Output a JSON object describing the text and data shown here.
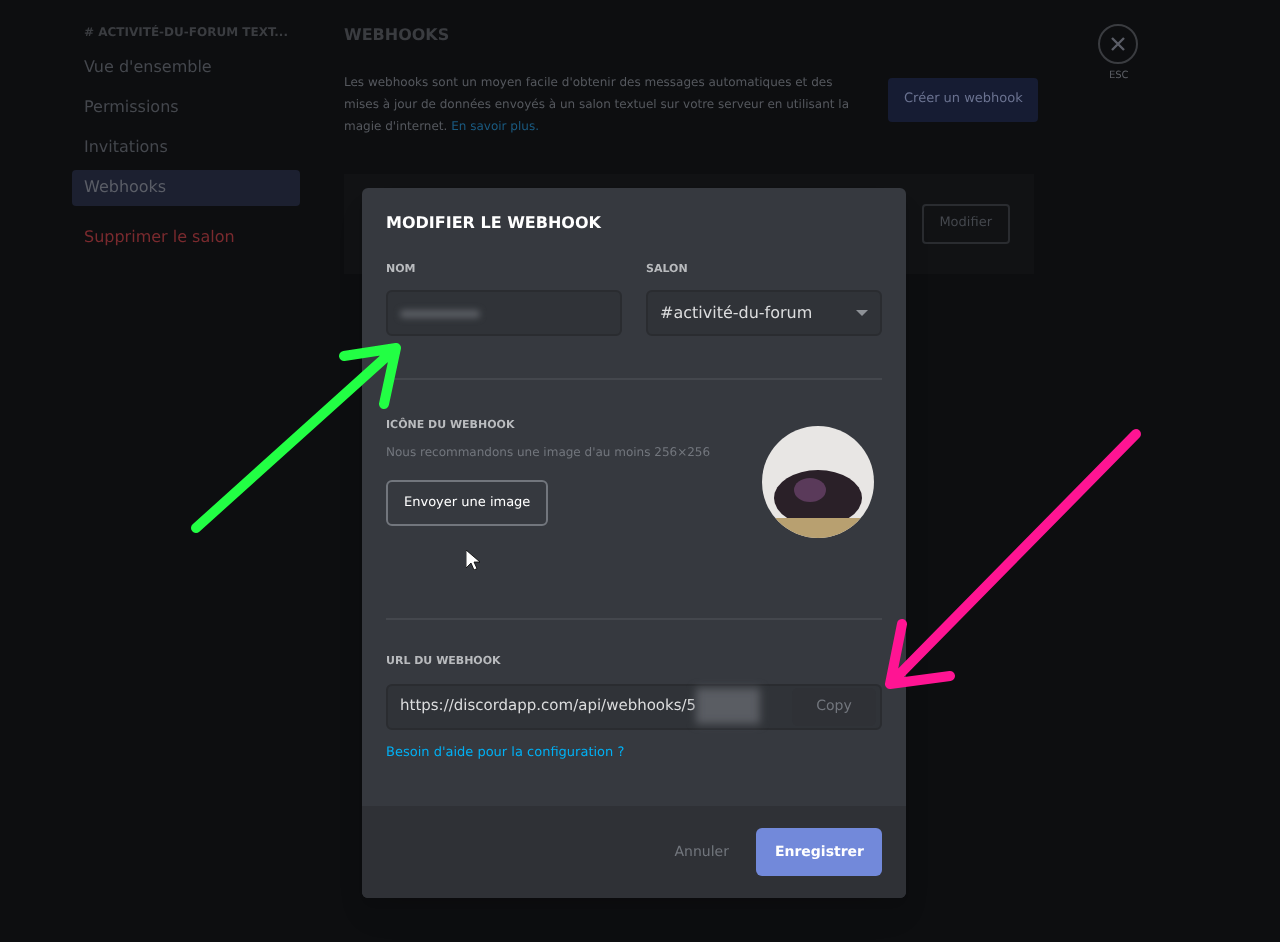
{
  "sidebar": {
    "header": "# ACTIVITÉ-DU-FORUM TEXT...",
    "items": [
      {
        "label": "Vue d'ensemble",
        "selected": false
      },
      {
        "label": "Permissions",
        "selected": false
      },
      {
        "label": "Invitations",
        "selected": false
      },
      {
        "label": "Webhooks",
        "selected": true
      }
    ],
    "delete_label": "Supprimer le salon"
  },
  "page": {
    "title": "WEBHOOKS",
    "description": "Les webhooks sont un moyen facile d'obtenir des messages automatiques et des mises à jour de données envoyés à un salon textuel sur votre serveur en utilisant la magie d'internet.",
    "learn_more": "En savoir plus.",
    "create_button": "Créer un webhook",
    "edit_button": "Modifier",
    "close_label": "ESC"
  },
  "modal": {
    "title": "MODIFIER LE WEBHOOK",
    "name_label": "NOM",
    "channel_label": "SALON",
    "channel_value": "#activité-du-forum",
    "icon_label": "ICÔNE DU WEBHOOK",
    "icon_hint": "Nous recommandons une image d'au moins 256×256",
    "upload_button": "Envoyer une image",
    "url_label": "URL DU WEBHOOK",
    "url_value": "https://discordapp.com/api/webhooks/5",
    "copy_button": "Copy",
    "help_link": "Besoin d'aide pour la configuration ?",
    "cancel_button": "Annuler",
    "save_button": "Enregistrer"
  }
}
